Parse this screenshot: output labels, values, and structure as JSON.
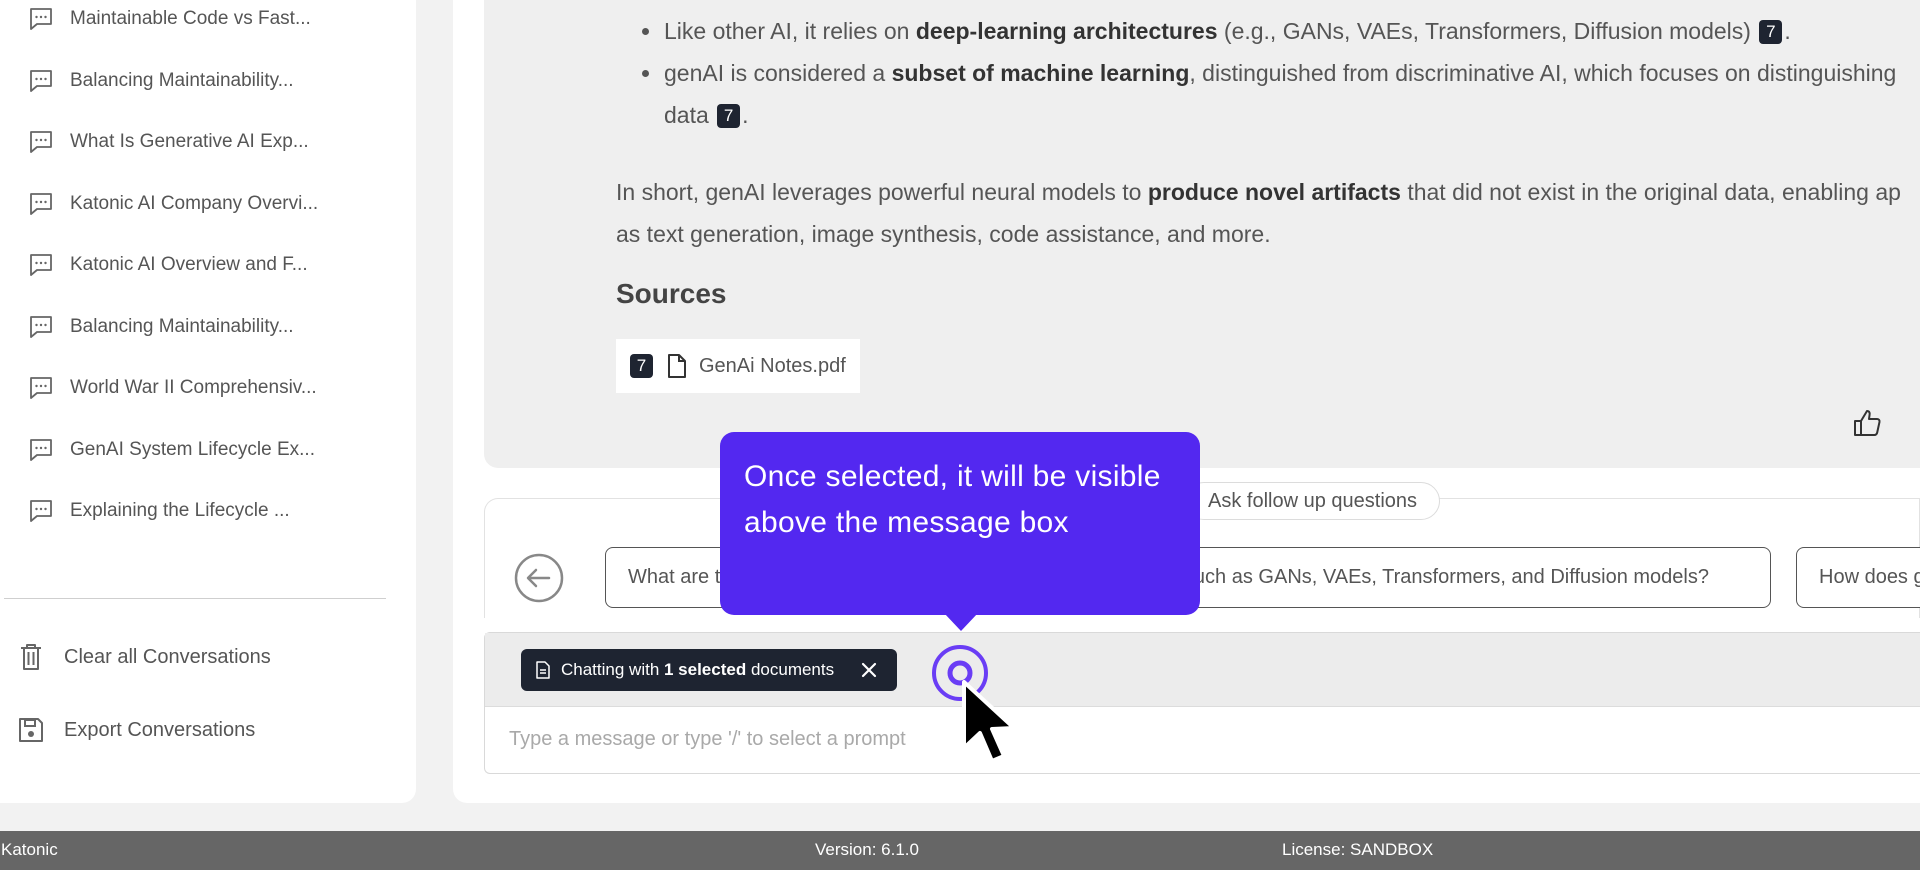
{
  "sidebar": {
    "conversations": [
      {
        "label": "Maintainable Code vs Fast..."
      },
      {
        "label": "Balancing Maintainability..."
      },
      {
        "label": "What Is Generative AI Exp..."
      },
      {
        "label": "Katonic AI Company Overvi..."
      },
      {
        "label": "Katonic AI Overview and F..."
      },
      {
        "label": "Balancing Maintainability..."
      },
      {
        "label": "World War II Comprehensiv..."
      },
      {
        "label": "GenAI System Lifecycle Ex..."
      },
      {
        "label": "Explaining the Lifecycle ..."
      }
    ],
    "clear_label": "Clear all Conversations",
    "export_label": "Export Conversations"
  },
  "answer": {
    "b1_pre": "Like other AI, it relies on ",
    "b1_bold": "deep-learning architectures",
    "b1_post": " (e.g., GANs, VAEs, Transformers, Diffusion models) ",
    "b1_cite": "7",
    "b1_end": ".",
    "b2_pre": "genAI is considered a ",
    "b2_bold": "subset of machine learning",
    "b2_post": ", distinguished from discriminative AI, which focuses on distinguishing",
    "b2_line2": "data ",
    "b2_cite": "7",
    "b2_end": ".",
    "summary_pre": "In short, genAI leverages powerful neural models to ",
    "summary_bold": "produce novel artifacts",
    "summary_post": " that did not exist in the original data, enabling ap",
    "summary_line2": "as text generation, image synthesis, code assistance, and more.",
    "sources_heading": "Sources",
    "source_cite": "7",
    "source_file": "GenAi Notes.pdf"
  },
  "followup": {
    "label": "Ask follow up questions",
    "suggestion_1_pre": "What are t",
    "suggestion_1_post": "I, such as GANs, VAEs, Transformers, and Diffusion models?",
    "suggestion_2": "How does g"
  },
  "chat": {
    "chip_pre": "Chatting with ",
    "chip_bold": "1 selected",
    "chip_post": " documents",
    "placeholder": "Type a message or type '/' to select a prompt"
  },
  "tooltip": {
    "text": "Once selected, it will be visible above the message box"
  },
  "footer": {
    "brand": "Katonic",
    "version": "Version: 6.1.0",
    "license": "License: SANDBOX"
  }
}
